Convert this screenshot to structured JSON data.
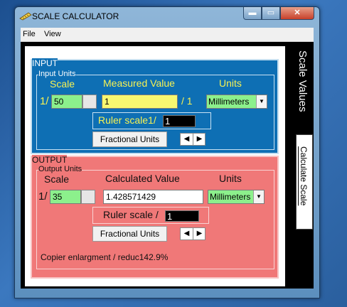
{
  "window": {
    "title": "SCALE CALCULATOR",
    "minimize_glyph": "▬",
    "maximize_glyph": "▭",
    "close_glyph": "✕"
  },
  "menu": {
    "items": [
      "File",
      "View"
    ]
  },
  "tabs": {
    "scale_values": "Scale Values",
    "calculate_scale": "Calculate Scale"
  },
  "input": {
    "section_title": "INPUT",
    "group_title": "Input Units",
    "scale_label": "Scale",
    "measured_label": "Measured Value",
    "units_label": "Units",
    "scale_prefix": "1/",
    "scale_value": "50",
    "measured_value": "1",
    "divider_text": "/ 1",
    "units_value": "Millimeters",
    "ruler_label": "Ruler scale1/",
    "ruler_value": "1",
    "fractional_button": "Fractional Units"
  },
  "output": {
    "section_title": "OUTPUT",
    "group_title": "Output Units",
    "scale_label": "Scale",
    "calculated_label": "Calculated  Value",
    "units_label": "Units",
    "scale_prefix": "1/",
    "scale_value": "35",
    "calculated_value": "1.428571429",
    "units_value": "Millimeters",
    "ruler_label": "Ruler scale /",
    "ruler_value": "1",
    "fractional_button": "Fractional Units",
    "copier_text": "Copier enlargment / reduc",
    "copier_value": "142.9%"
  },
  "colors": {
    "input_bg": "#0e6fb4",
    "output_bg": "#f07878",
    "label_yellow": "#f7f252",
    "field_green": "#8cf08c",
    "field_yellow": "#f8f870"
  },
  "icons": {
    "spin_left": "◀",
    "spin_right": "▶",
    "dropdown": "▼"
  }
}
